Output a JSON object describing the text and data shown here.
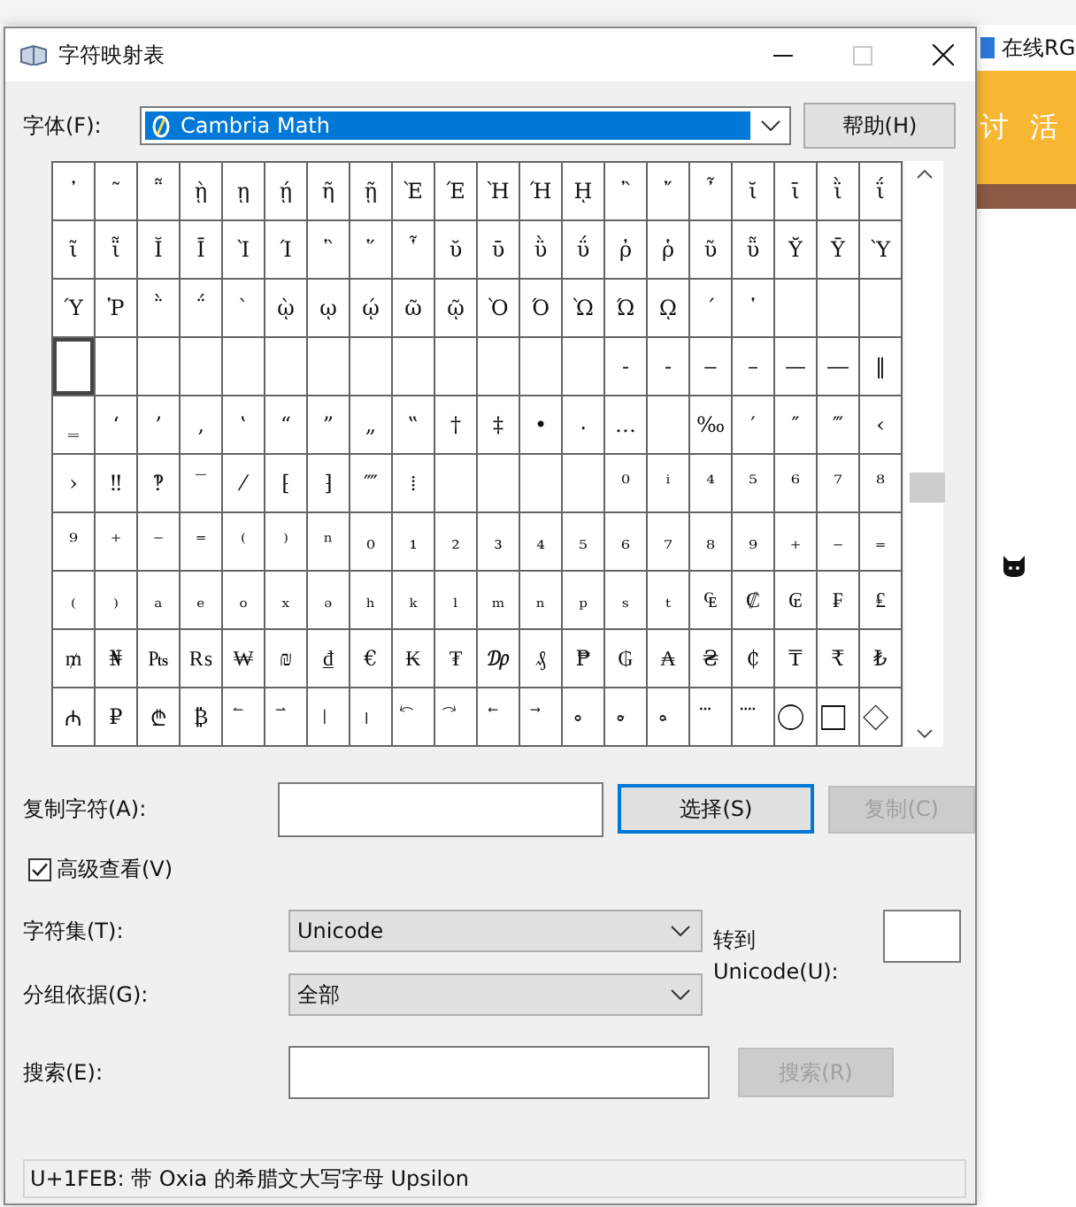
{
  "window": {
    "title": "字符映射表"
  },
  "font": {
    "label": "字体(F):",
    "value": "Cambria Math"
  },
  "help_button": {
    "label": "帮助(H)"
  },
  "grid": {
    "rows": [
      [
        {
          "char": "᾽",
          "selected": false
        },
        {
          "char": "῀",
          "selected": false
        },
        {
          "char": "῁",
          "selected": false
        },
        {
          "char": "ῂ",
          "selected": false
        },
        {
          "char": "ῃ",
          "selected": false
        },
        {
          "char": "ῄ",
          "selected": false
        },
        {
          "char": "ῆ",
          "selected": false
        },
        {
          "char": "ῇ",
          "selected": false
        },
        {
          "char": "Ὲ",
          "selected": false
        },
        {
          "char": "Έ",
          "selected": false
        },
        {
          "char": "Ὴ",
          "selected": false
        },
        {
          "char": "Ή",
          "selected": false
        },
        {
          "char": "ῌ",
          "selected": false
        },
        {
          "char": "῍",
          "selected": false
        },
        {
          "char": "῎",
          "selected": false
        },
        {
          "char": "῏",
          "selected": false
        },
        {
          "char": "ῐ",
          "selected": false
        },
        {
          "char": "ῑ",
          "selected": false
        },
        {
          "char": "ῒ",
          "selected": false
        },
        {
          "char": "ΐ",
          "selected": false
        }
      ],
      [
        {
          "char": "ῖ",
          "selected": false
        },
        {
          "char": "ῗ",
          "selected": false
        },
        {
          "char": "Ῐ",
          "selected": false
        },
        {
          "char": "Ῑ",
          "selected": false
        },
        {
          "char": "Ὶ",
          "selected": false
        },
        {
          "char": "Ί",
          "selected": false
        },
        {
          "char": "῝",
          "selected": false
        },
        {
          "char": "῞",
          "selected": false
        },
        {
          "char": "῟",
          "selected": false
        },
        {
          "char": "ῠ",
          "selected": false
        },
        {
          "char": "ῡ",
          "selected": false
        },
        {
          "char": "ῢ",
          "selected": false
        },
        {
          "char": "ΰ",
          "selected": false
        },
        {
          "char": "ῤ",
          "selected": false
        },
        {
          "char": "ῥ",
          "selected": false
        },
        {
          "char": "ῦ",
          "selected": false
        },
        {
          "char": "ῧ",
          "selected": false
        },
        {
          "char": "Ῠ",
          "selected": false
        },
        {
          "char": "Ῡ",
          "selected": false
        },
        {
          "char": "Ὺ",
          "selected": false
        }
      ],
      [
        {
          "char": "Ύ",
          "selected": false
        },
        {
          "char": "Ῥ",
          "selected": false
        },
        {
          "char": "῭",
          "selected": false
        },
        {
          "char": "΅",
          "selected": false
        },
        {
          "char": "`",
          "selected": false
        },
        {
          "char": "ῲ",
          "selected": false
        },
        {
          "char": "ῳ",
          "selected": false
        },
        {
          "char": "ῴ",
          "selected": false
        },
        {
          "char": "ῶ",
          "selected": false
        },
        {
          "char": "ῷ",
          "selected": false
        },
        {
          "char": "Ὸ",
          "selected": false
        },
        {
          "char": "Ό",
          "selected": false
        },
        {
          "char": "Ὼ",
          "selected": false
        },
        {
          "char": "Ώ",
          "selected": false
        },
        {
          "char": "ῼ",
          "selected": false
        },
        {
          "char": "´",
          "selected": false
        },
        {
          "char": "῾",
          "selected": false
        },
        {
          "selected": false
        },
        {
          "selected": false
        },
        {
          "selected": false
        }
      ],
      [
        {
          "selected": true
        },
        {
          "selected": false
        },
        {
          "selected": false
        },
        {
          "selected": false
        },
        {
          "selected": false
        },
        {
          "selected": false
        },
        {
          "selected": false
        },
        {
          "selected": false
        },
        {
          "selected": false
        },
        {
          "selected": false
        },
        {
          "selected": false
        },
        {
          "selected": false
        },
        {
          "selected": false
        },
        {
          "char": "‐",
          "selected": false
        },
        {
          "char": "‑",
          "selected": false
        },
        {
          "char": "‒",
          "selected": false
        },
        {
          "char": "–",
          "selected": false
        },
        {
          "char": "—",
          "selected": false
        },
        {
          "char": "―",
          "selected": false
        },
        {
          "char": "‖",
          "selected": false
        }
      ],
      [
        {
          "char": "‗",
          "selected": false
        },
        {
          "char": "‘",
          "selected": false
        },
        {
          "char": "’",
          "selected": false
        },
        {
          "char": "‚",
          "selected": false
        },
        {
          "char": "‛",
          "selected": false
        },
        {
          "char": "“",
          "selected": false
        },
        {
          "char": "”",
          "selected": false
        },
        {
          "char": "„",
          "selected": false
        },
        {
          "char": "‟",
          "selected": false
        },
        {
          "char": "†",
          "selected": false
        },
        {
          "char": "‡",
          "selected": false
        },
        {
          "char": "•",
          "selected": false
        },
        {
          "char": "‧",
          "selected": false
        },
        {
          "char": "…",
          "selected": false
        },
        {
          "selected": false
        },
        {
          "char": "‰",
          "selected": false
        },
        {
          "char": "′",
          "selected": false
        },
        {
          "char": "″",
          "selected": false
        },
        {
          "char": "‴",
          "selected": false
        },
        {
          "char": "‹",
          "selected": false
        }
      ],
      [
        {
          "char": "›",
          "selected": false
        },
        {
          "char": "‼",
          "selected": false
        },
        {
          "char": "‽",
          "selected": false
        },
        {
          "char": "‾",
          "selected": false
        },
        {
          "char": "⁄",
          "selected": false
        },
        {
          "char": "⁅",
          "selected": false
        },
        {
          "char": "⁆",
          "selected": false
        },
        {
          "char": "⁗",
          "selected": false
        },
        {
          "char": "⁞",
          "selected": false
        },
        {
          "selected": false
        },
        {
          "selected": false
        },
        {
          "selected": false
        },
        {
          "selected": false
        },
        {
          "char": "⁰",
          "selected": false
        },
        {
          "char": "ⁱ",
          "selected": false
        },
        {
          "char": "⁴",
          "selected": false
        },
        {
          "char": "⁵",
          "selected": false
        },
        {
          "char": "⁶",
          "selected": false
        },
        {
          "char": "⁷",
          "selected": false
        },
        {
          "char": "⁸",
          "selected": false
        }
      ],
      [
        {
          "char": "⁹",
          "selected": false
        },
        {
          "char": "⁺",
          "selected": false
        },
        {
          "char": "⁻",
          "selected": false
        },
        {
          "char": "⁼",
          "selected": false
        },
        {
          "char": "⁽",
          "selected": false
        },
        {
          "char": "⁾",
          "selected": false
        },
        {
          "char": "ⁿ",
          "selected": false
        },
        {
          "char": "₀",
          "selected": false
        },
        {
          "char": "₁",
          "selected": false
        },
        {
          "char": "₂",
          "selected": false
        },
        {
          "char": "₃",
          "selected": false
        },
        {
          "char": "₄",
          "selected": false
        },
        {
          "char": "₅",
          "selected": false
        },
        {
          "char": "₆",
          "selected": false
        },
        {
          "char": "₇",
          "selected": false
        },
        {
          "char": "₈",
          "selected": false
        },
        {
          "char": "₉",
          "selected": false
        },
        {
          "char": "₊",
          "selected": false
        },
        {
          "char": "₋",
          "selected": false
        },
        {
          "char": "₌",
          "selected": false
        }
      ],
      [
        {
          "char": "₍",
          "selected": false
        },
        {
          "char": "₎",
          "selected": false
        },
        {
          "char": "ₐ",
          "selected": false
        },
        {
          "char": "ₑ",
          "selected": false
        },
        {
          "char": "ₒ",
          "selected": false
        },
        {
          "char": "ₓ",
          "selected": false
        },
        {
          "char": "ₔ",
          "selected": false
        },
        {
          "char": "ₕ",
          "selected": false
        },
        {
          "char": "ₖ",
          "selected": false
        },
        {
          "char": "ₗ",
          "selected": false
        },
        {
          "char": "ₘ",
          "selected": false
        },
        {
          "char": "ₙ",
          "selected": false
        },
        {
          "char": "ₚ",
          "selected": false
        },
        {
          "char": "ₛ",
          "selected": false
        },
        {
          "char": "ₜ",
          "selected": false
        },
        {
          "char": "₠",
          "selected": false
        },
        {
          "char": "₡",
          "selected": false
        },
        {
          "char": "₢",
          "selected": false
        },
        {
          "char": "₣",
          "selected": false
        },
        {
          "char": "₤",
          "selected": false
        }
      ],
      [
        {
          "char": "₥",
          "selected": false
        },
        {
          "char": "₦",
          "selected": false
        },
        {
          "char": "₧",
          "selected": false
        },
        {
          "char": "₨",
          "selected": false
        },
        {
          "char": "₩",
          "selected": false
        },
        {
          "char": "₪",
          "selected": false
        },
        {
          "char": "₫",
          "selected": false
        },
        {
          "char": "€",
          "selected": false
        },
        {
          "char": "₭",
          "selected": false
        },
        {
          "char": "₮",
          "selected": false
        },
        {
          "char": "₯",
          "selected": false
        },
        {
          "char": "₰",
          "selected": false
        },
        {
          "char": "₱",
          "selected": false
        },
        {
          "char": "₲",
          "selected": false
        },
        {
          "char": "₳",
          "selected": false
        },
        {
          "char": "₴",
          "selected": false
        },
        {
          "char": "₵",
          "selected": false
        },
        {
          "char": "₸",
          "selected": false
        },
        {
          "char": "₹",
          "selected": false
        },
        {
          "char": "₺",
          "selected": false
        }
      ],
      [
        {
          "char": "₼",
          "selected": false
        },
        {
          "char": "₽",
          "selected": false
        },
        {
          "char": "₾",
          "selected": false
        },
        {
          "char": "₿",
          "selected": false
        },
        {
          "char": " ⃐",
          "selected": false
        },
        {
          "char": " ⃑",
          "selected": false
        },
        {
          "char": " ⃒",
          "selected": false
        },
        {
          "char": " ⃓",
          "selected": false
        },
        {
          "char": " ⃔",
          "selected": false
        },
        {
          "char": " ⃕",
          "selected": false
        },
        {
          "char": " ⃖",
          "selected": false
        },
        {
          "char": " ⃗",
          "selected": false
        },
        {
          "char": " ⃘",
          "selected": false
        },
        {
          "char": " ⃙",
          "selected": false
        },
        {
          "char": " ⃚",
          "selected": false
        },
        {
          "char": " ⃛",
          "selected": false
        },
        {
          "char": " ⃜",
          "selected": false
        },
        {
          "char": " ⃝",
          "selected": false
        },
        {
          "char": " ⃞",
          "selected": false
        },
        {
          "char": " ⃟",
          "selected": false
        }
      ]
    ]
  },
  "copy": {
    "label": "复制字符(A):",
    "select_button": {
      "label": "选择(S)",
      "focused": true
    },
    "copy_button": {
      "label": "复制(C)",
      "disabled": true
    }
  },
  "advanced_view": {
    "label": "高级查看(V)",
    "checked": true
  },
  "charset": {
    "label": "字符集(T):",
    "value": "Unicode"
  },
  "goto_unicode": {
    "label": "转到 Unicode(U):"
  },
  "group_by": {
    "label": "分组依据(G):",
    "value": "全部"
  },
  "search": {
    "label": "搜索(E):",
    "button": {
      "label": "搜索(R)",
      "disabled": true
    }
  },
  "status_bar": "U+1FEB: 带 Oxia 的希腊文大写字母 Upsilon",
  "background": {
    "tab_text": "在线RG",
    "banner_texts": [
      "讨",
      "活"
    ]
  }
}
